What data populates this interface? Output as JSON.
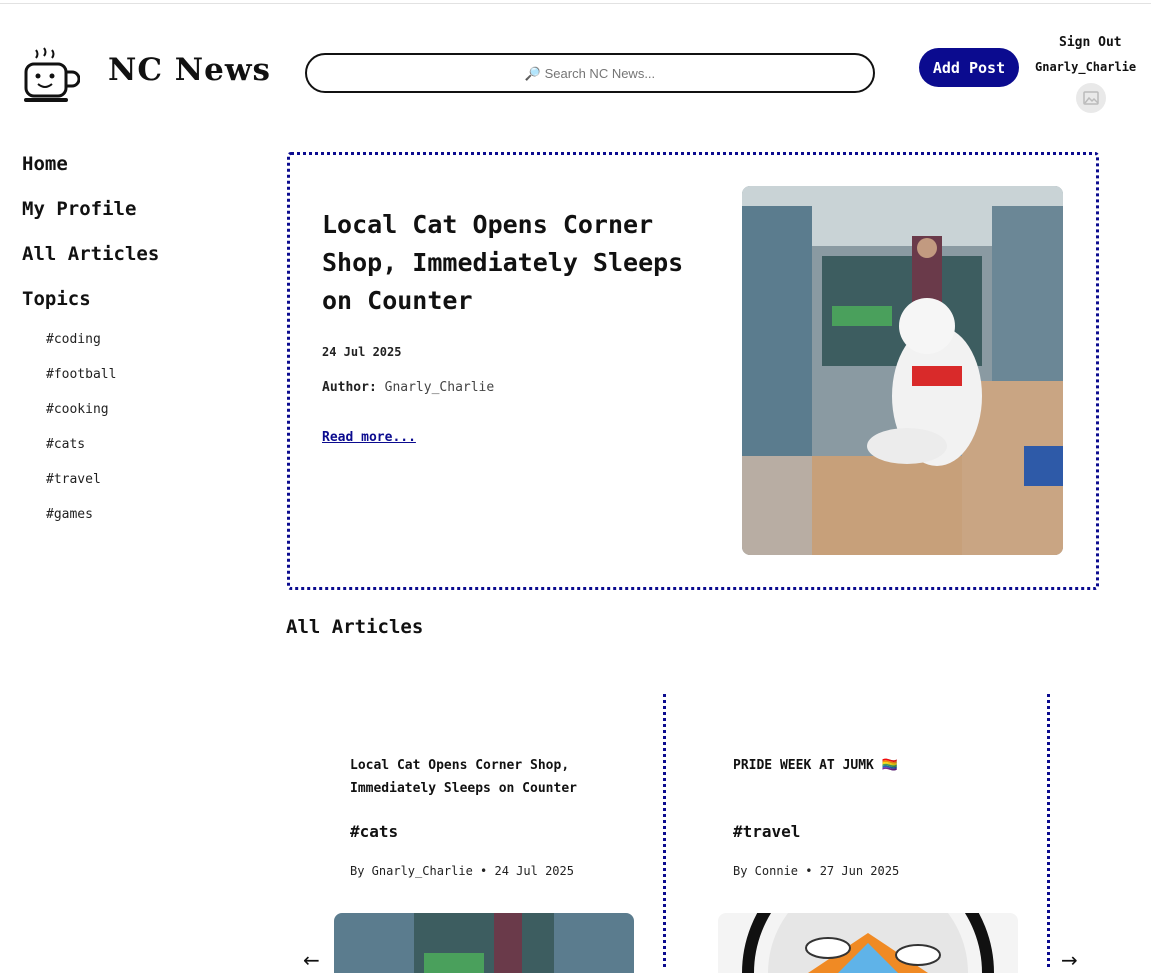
{
  "header": {
    "logo_text": "NC News",
    "search_placeholder": "🔎 Search NC News...",
    "add_post_label": "Add Post",
    "sign_out_label": "Sign Out",
    "username": "Gnarly_Charlie"
  },
  "sidebar": {
    "nav": [
      "Home",
      "My Profile",
      "All Articles",
      "Topics"
    ],
    "topics": [
      "#coding",
      "#football",
      "#cooking",
      "#cats",
      "#travel",
      "#games"
    ]
  },
  "featured": {
    "title": "Local Cat Opens Corner Shop, Immediately Sleeps on Counter",
    "date": "24 Jul 2025",
    "author_label": "Author:",
    "author": "Gnarly_Charlie",
    "read_more": "Read more..."
  },
  "main": {
    "section_title": "All Articles"
  },
  "cards": [
    {
      "title": "Local Cat Opens Corner Shop, Immediately Sleeps on Counter",
      "tag": "#cats",
      "meta": "By Gnarly_Charlie • 24 Jul 2025"
    },
    {
      "title": "PRIDE WEEK AT JUMK 🏳️‍🌈",
      "tag": "#travel",
      "meta": "By Connie • 27 Jun 2025"
    }
  ],
  "carousel": {
    "prev_label": "←",
    "next_label": "→"
  }
}
